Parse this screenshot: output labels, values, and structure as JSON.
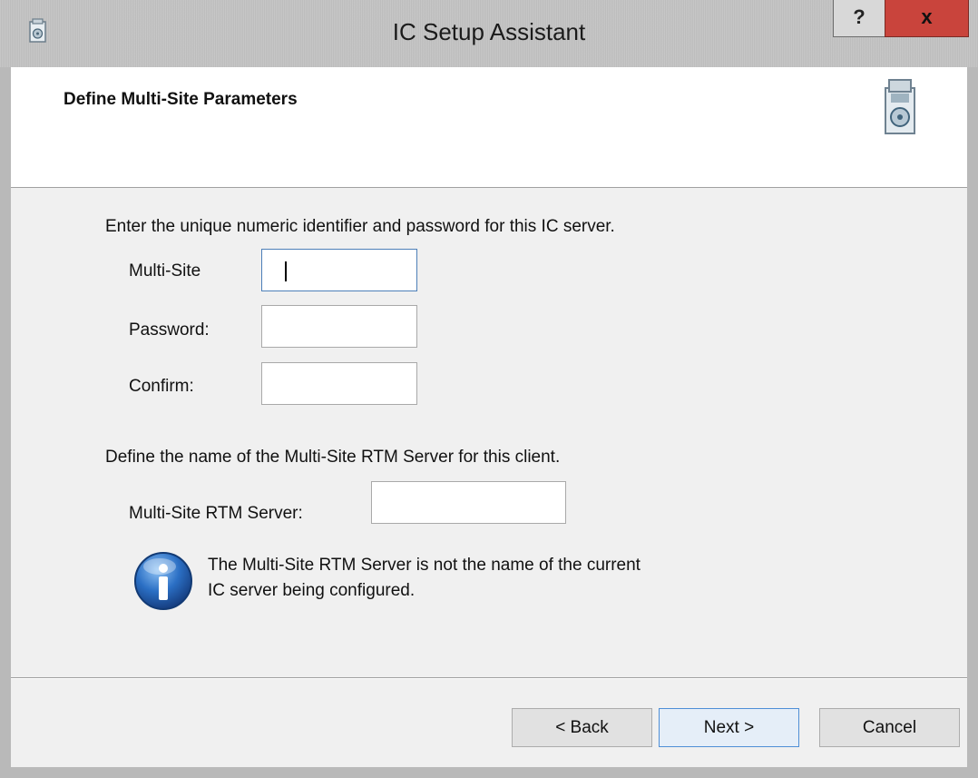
{
  "window": {
    "title": "IC Setup Assistant",
    "help_label": "?",
    "close_label": "x"
  },
  "header": {
    "title": "Define Multi-Site Parameters"
  },
  "section1": {
    "instruction": "Enter the unique numeric identifier and password for this IC server.",
    "fields": [
      {
        "label": "Multi-Site",
        "value": ""
      },
      {
        "label": "Password:",
        "value": ""
      },
      {
        "label": "Confirm:",
        "value": ""
      }
    ]
  },
  "section2": {
    "instruction": "Define the name of the Multi-Site RTM Server for this client.",
    "rtm_label": "Multi-Site RTM Server:",
    "rtm_value": ""
  },
  "info": {
    "line1": "The Multi-Site RTM Server is not the name of the current",
    "line2": "IC server being configured."
  },
  "buttons": {
    "back": "< Back",
    "next": "Next >",
    "cancel": "Cancel"
  }
}
